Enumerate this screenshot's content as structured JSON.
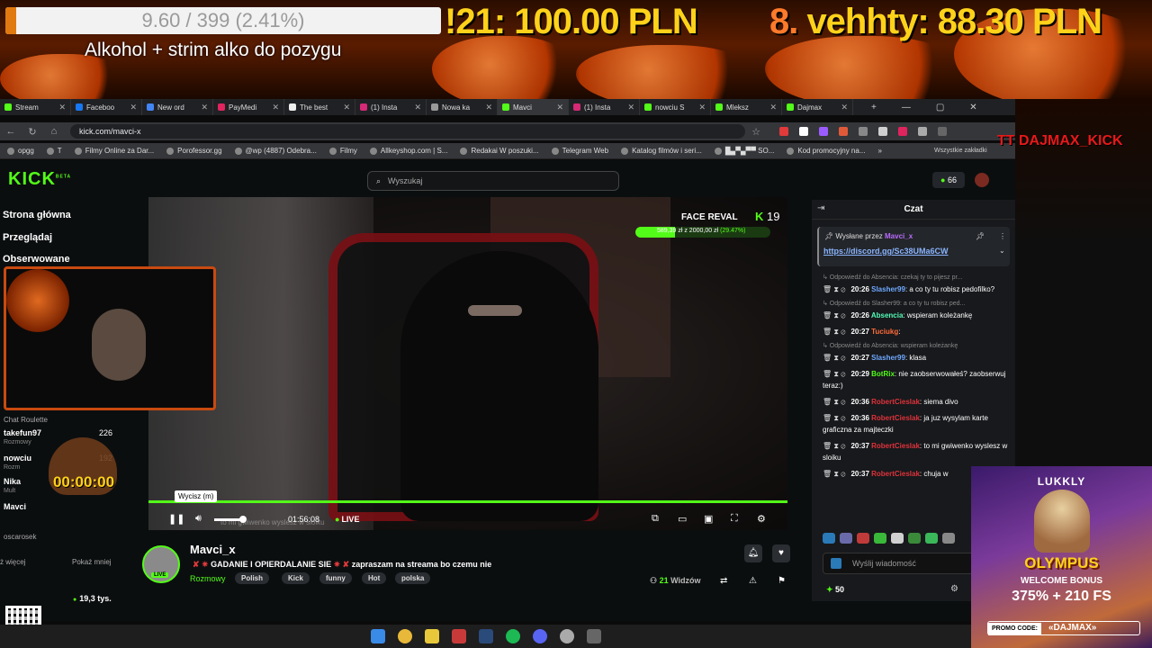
{
  "overlay": {
    "goal_text": "9.60 / 399 (2.41%)",
    "goal_progress": 0.0241,
    "goal_title": "Alkohol + strim alko do pozygu",
    "ticker_a": "!21: 100.00 PLN",
    "ticker_b_rank": "8.",
    "ticker_b_name": "vehhty: 88.30 PLN",
    "tt_label": "TT DAJMAX_KICK"
  },
  "browser": {
    "tabs": [
      {
        "label": "Stream",
        "color": "#53fc18"
      },
      {
        "label": "Faceboo",
        "color": "#1877f2"
      },
      {
        "label": "New ord",
        "color": "#4285f4"
      },
      {
        "label": "PayMedi",
        "color": "#e0245e"
      },
      {
        "label": "The best",
        "color": "#eeeeee"
      },
      {
        "label": "(1) Insta",
        "color": "#d62976"
      },
      {
        "label": "Nowa ka",
        "color": "#999999"
      },
      {
        "label": "Mavci",
        "color": "#53fc18",
        "active": true
      },
      {
        "label": "(1) Insta",
        "color": "#d62976"
      },
      {
        "label": "nowciu S",
        "color": "#53fc18"
      },
      {
        "label": "Mleksz",
        "color": "#53fc18"
      },
      {
        "label": "Dajmax",
        "color": "#53fc18"
      }
    ],
    "new_tab": "+",
    "min": "—",
    "max": "▢",
    "close": "✕",
    "url": "kick.com/mavci-x",
    "bookmarks": [
      "opgg",
      "T",
      "Filmy Online za Dar...",
      "Porofessor.gg",
      "@wp (4887) Odebra...",
      "Filmy",
      "Allkeyshop.com | S...",
      "Redakai W poszuki...",
      "Telegram Web",
      "Katalog filmów i seri...",
      "█▄▀▄▀▀ SO...",
      "Kod promocyjny na..."
    ],
    "bookmarks_more": "»",
    "bookmarks_all": "Wszystkie zakładki"
  },
  "kick": {
    "logo": "KICK",
    "logo_beta": "BETA",
    "search_placeholder": "Wyszukaj",
    "points": "66",
    "sidebar": {
      "home": "Strona główna",
      "browse": "Przeglądaj",
      "following": "Obserwowane",
      "section": "Chat Roulette",
      "rows": [
        {
          "name": "takefun97",
          "sub": "Rozmowy",
          "count": "226"
        },
        {
          "name": "nowciu",
          "sub": "Rozm",
          "count": "192"
        },
        {
          "name": "Nika",
          "sub": "Mult",
          "count": ""
        },
        {
          "name": "Mavci",
          "sub": "",
          "count": ""
        }
      ],
      "last": "oscarosek",
      "less": "ż więcej",
      "show_less": "Pokaż mniej",
      "followers": "19,3 tys."
    },
    "timer": "00:00:00",
    "player": {
      "goal_title": "FACE REVAL",
      "goal_k": "19",
      "goal_amount": "589,39 zł z 2000,00 zł",
      "goal_pct": "(29.47%)",
      "goal_progress": 0.2947,
      "tooltip": "Wycisz (m)",
      "time": "01:56:08",
      "live": "LIVE",
      "faint_sub": "to mi gwiwenko wyslesz w sloiku"
    },
    "streamer": {
      "name": "Mavci_x",
      "live_badge": "LIVE",
      "title": "GADANIE I OPIERDALANIE SIE",
      "title_tail": "zapraszam na streama bo czemu nie",
      "category": "Rozmowy",
      "tags": [
        "Polish",
        "Kick",
        "funny",
        "Hot",
        "polska"
      ],
      "viewers_num": "21",
      "viewers_label": "Widzów"
    },
    "chat": {
      "header": "Czat",
      "pinned_by_label": "Wysłane przez",
      "pinned_by": "Mavci_x",
      "pinned_link": "https://discord.gg/Sc38UMa6CW",
      "messages": [
        {
          "reply": "Odpowiedź do Absencia: czekaj ty to pijesz pr...",
          "time": "20:26",
          "user": "Slasher99",
          "color": "#6fa8ff",
          "text": ": a co ty tu robisz pedofilko?"
        },
        {
          "reply": "Odpowiedź do Slasher99: a co ty tu robisz ped...",
          "time": "20:26",
          "user": "Absencia",
          "color": "#53fcb8",
          "text": ": wspieram koleżankę"
        },
        {
          "reply": "",
          "time": "20:27",
          "user": "Tuciukg",
          "color": "#ff6a3a",
          "text": ":"
        },
        {
          "reply": "Odpowiedź do Absencia: wspieram koleżankę",
          "time": "20:27",
          "user": "Slasher99",
          "color": "#6fa8ff",
          "text": ": klasa"
        },
        {
          "reply": "",
          "time": "20:29",
          "user": "BotRix",
          "color": "#53fc18",
          "text": ": nie zaobserwowałeś? zaobserwuj teraz:)"
        },
        {
          "reply": "",
          "time": "20:36",
          "user": "RobertCieslak",
          "color": "#e0323a",
          "text": ": siema divo"
        },
        {
          "reply": "",
          "time": "20:36",
          "user": "RobertCieslak",
          "color": "#e0323a",
          "text": ": ja juz wysylam karte graficzna za majteczki"
        },
        {
          "reply": "",
          "time": "20:37",
          "user": "RobertCieslak",
          "color": "#e0323a",
          "text": ": to mi gwiwenko wyslesz w sloiku"
        },
        {
          "reply": "",
          "time": "20:37",
          "user": "RobertCieslak",
          "color": "#e0323a",
          "text": ": chuja w"
        }
      ],
      "input_placeholder": "Wyślij wiadomość",
      "points": "50"
    }
  },
  "ad": {
    "brand": "LUKKLY",
    "title": "OLYMPUS",
    "welcome": "WELCOME BONUS",
    "bonus": "375% + 210 FS",
    "promo_label": "PROMO CODE:",
    "promo_code": "«DAJMAX»"
  }
}
